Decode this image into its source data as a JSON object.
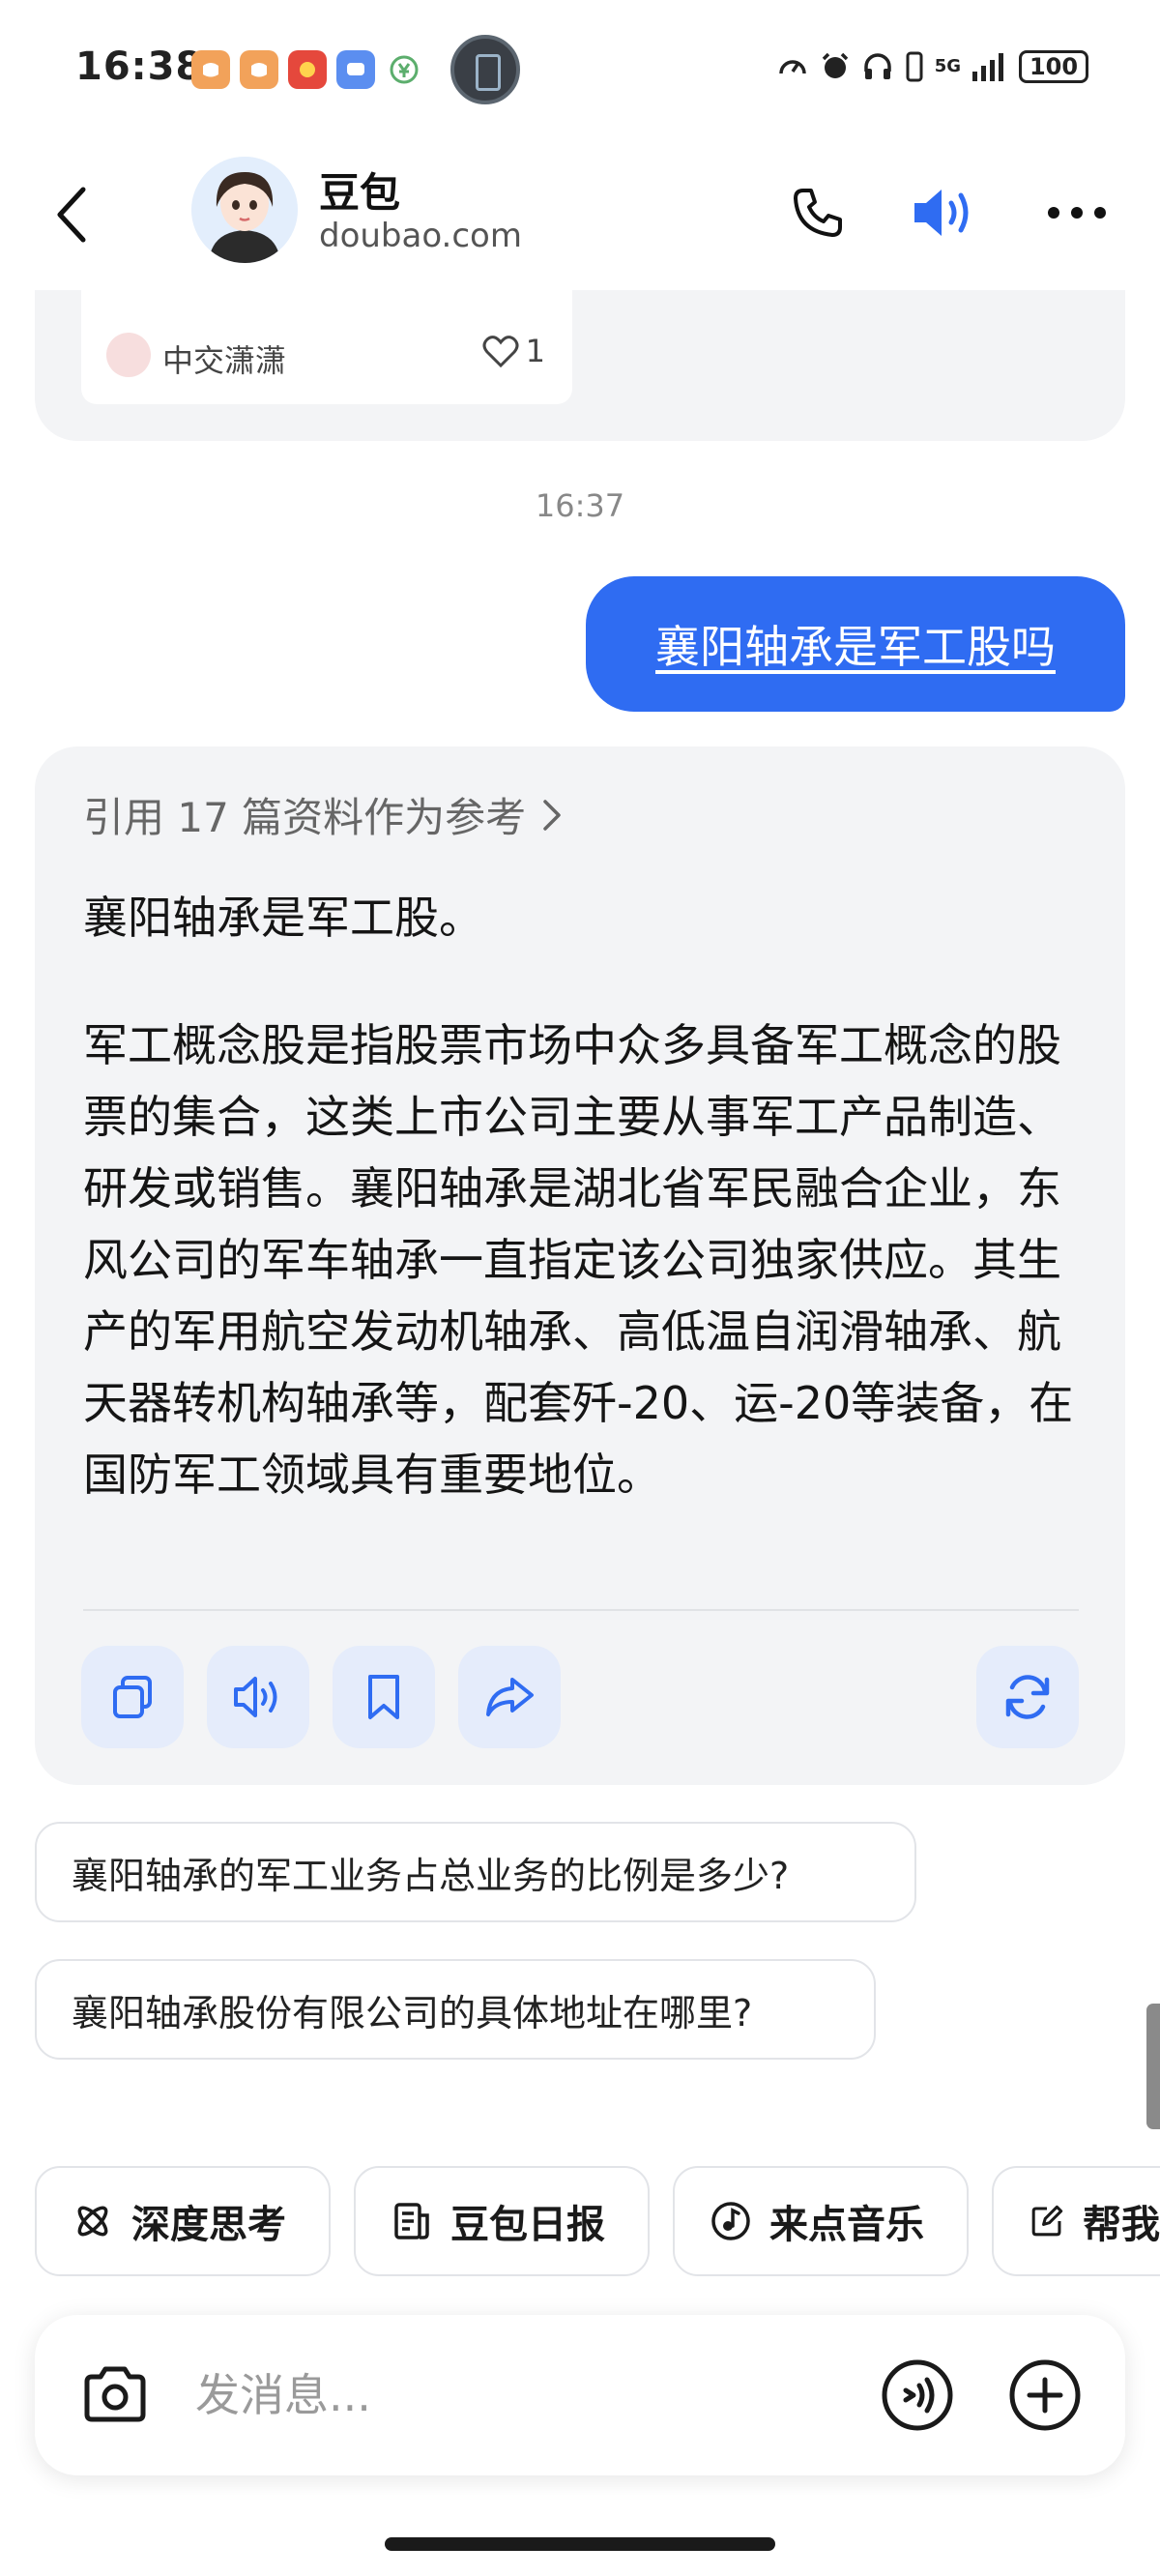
{
  "status_bar": {
    "time": "16:38",
    "network": "5G",
    "battery": "100"
  },
  "header": {
    "bot_name": "豆包",
    "bot_domain": "doubao.com"
  },
  "previous_card": {
    "author": "中交潇潇",
    "likes": "1"
  },
  "timestamp": "16:37",
  "user_message": "襄阳轴承是军工股吗",
  "answer": {
    "reference_link": "引用 17 篇资料作为参考",
    "lead": "襄阳轴承是军工股。",
    "body": "军工概念股是指股票市场中众多具备军工概念的股票的集合，这类上市公司主要从事军工产品制造、研发或销售。襄阳轴承是湖北省军民融合企业，东风公司的军车轴承一直指定该公司独家供应。其生产的军用航空发动机轴承、高低温自润滑轴承、航天器转机构轴承等，配套歼-20、运-20等装备，在国防军工领域具有重要地位。"
  },
  "suggestions": [
    "襄阳轴承的军工业务占总业务的比例是多少?",
    "襄阳轴承股份有限公司的具体地址在哪里?"
  ],
  "quick_actions": [
    {
      "label": "深度思考",
      "icon": "atom-icon"
    },
    {
      "label": "豆包日报",
      "icon": "newspaper-icon"
    },
    {
      "label": "来点音乐",
      "icon": "music-note-icon"
    },
    {
      "label": "帮我",
      "icon": "edit-icon"
    }
  ],
  "input": {
    "placeholder": "发消息..."
  },
  "colors": {
    "accent": "#2f6cf2",
    "card_bg": "#f3f4f6",
    "action_bg": "#e5ecfb"
  }
}
